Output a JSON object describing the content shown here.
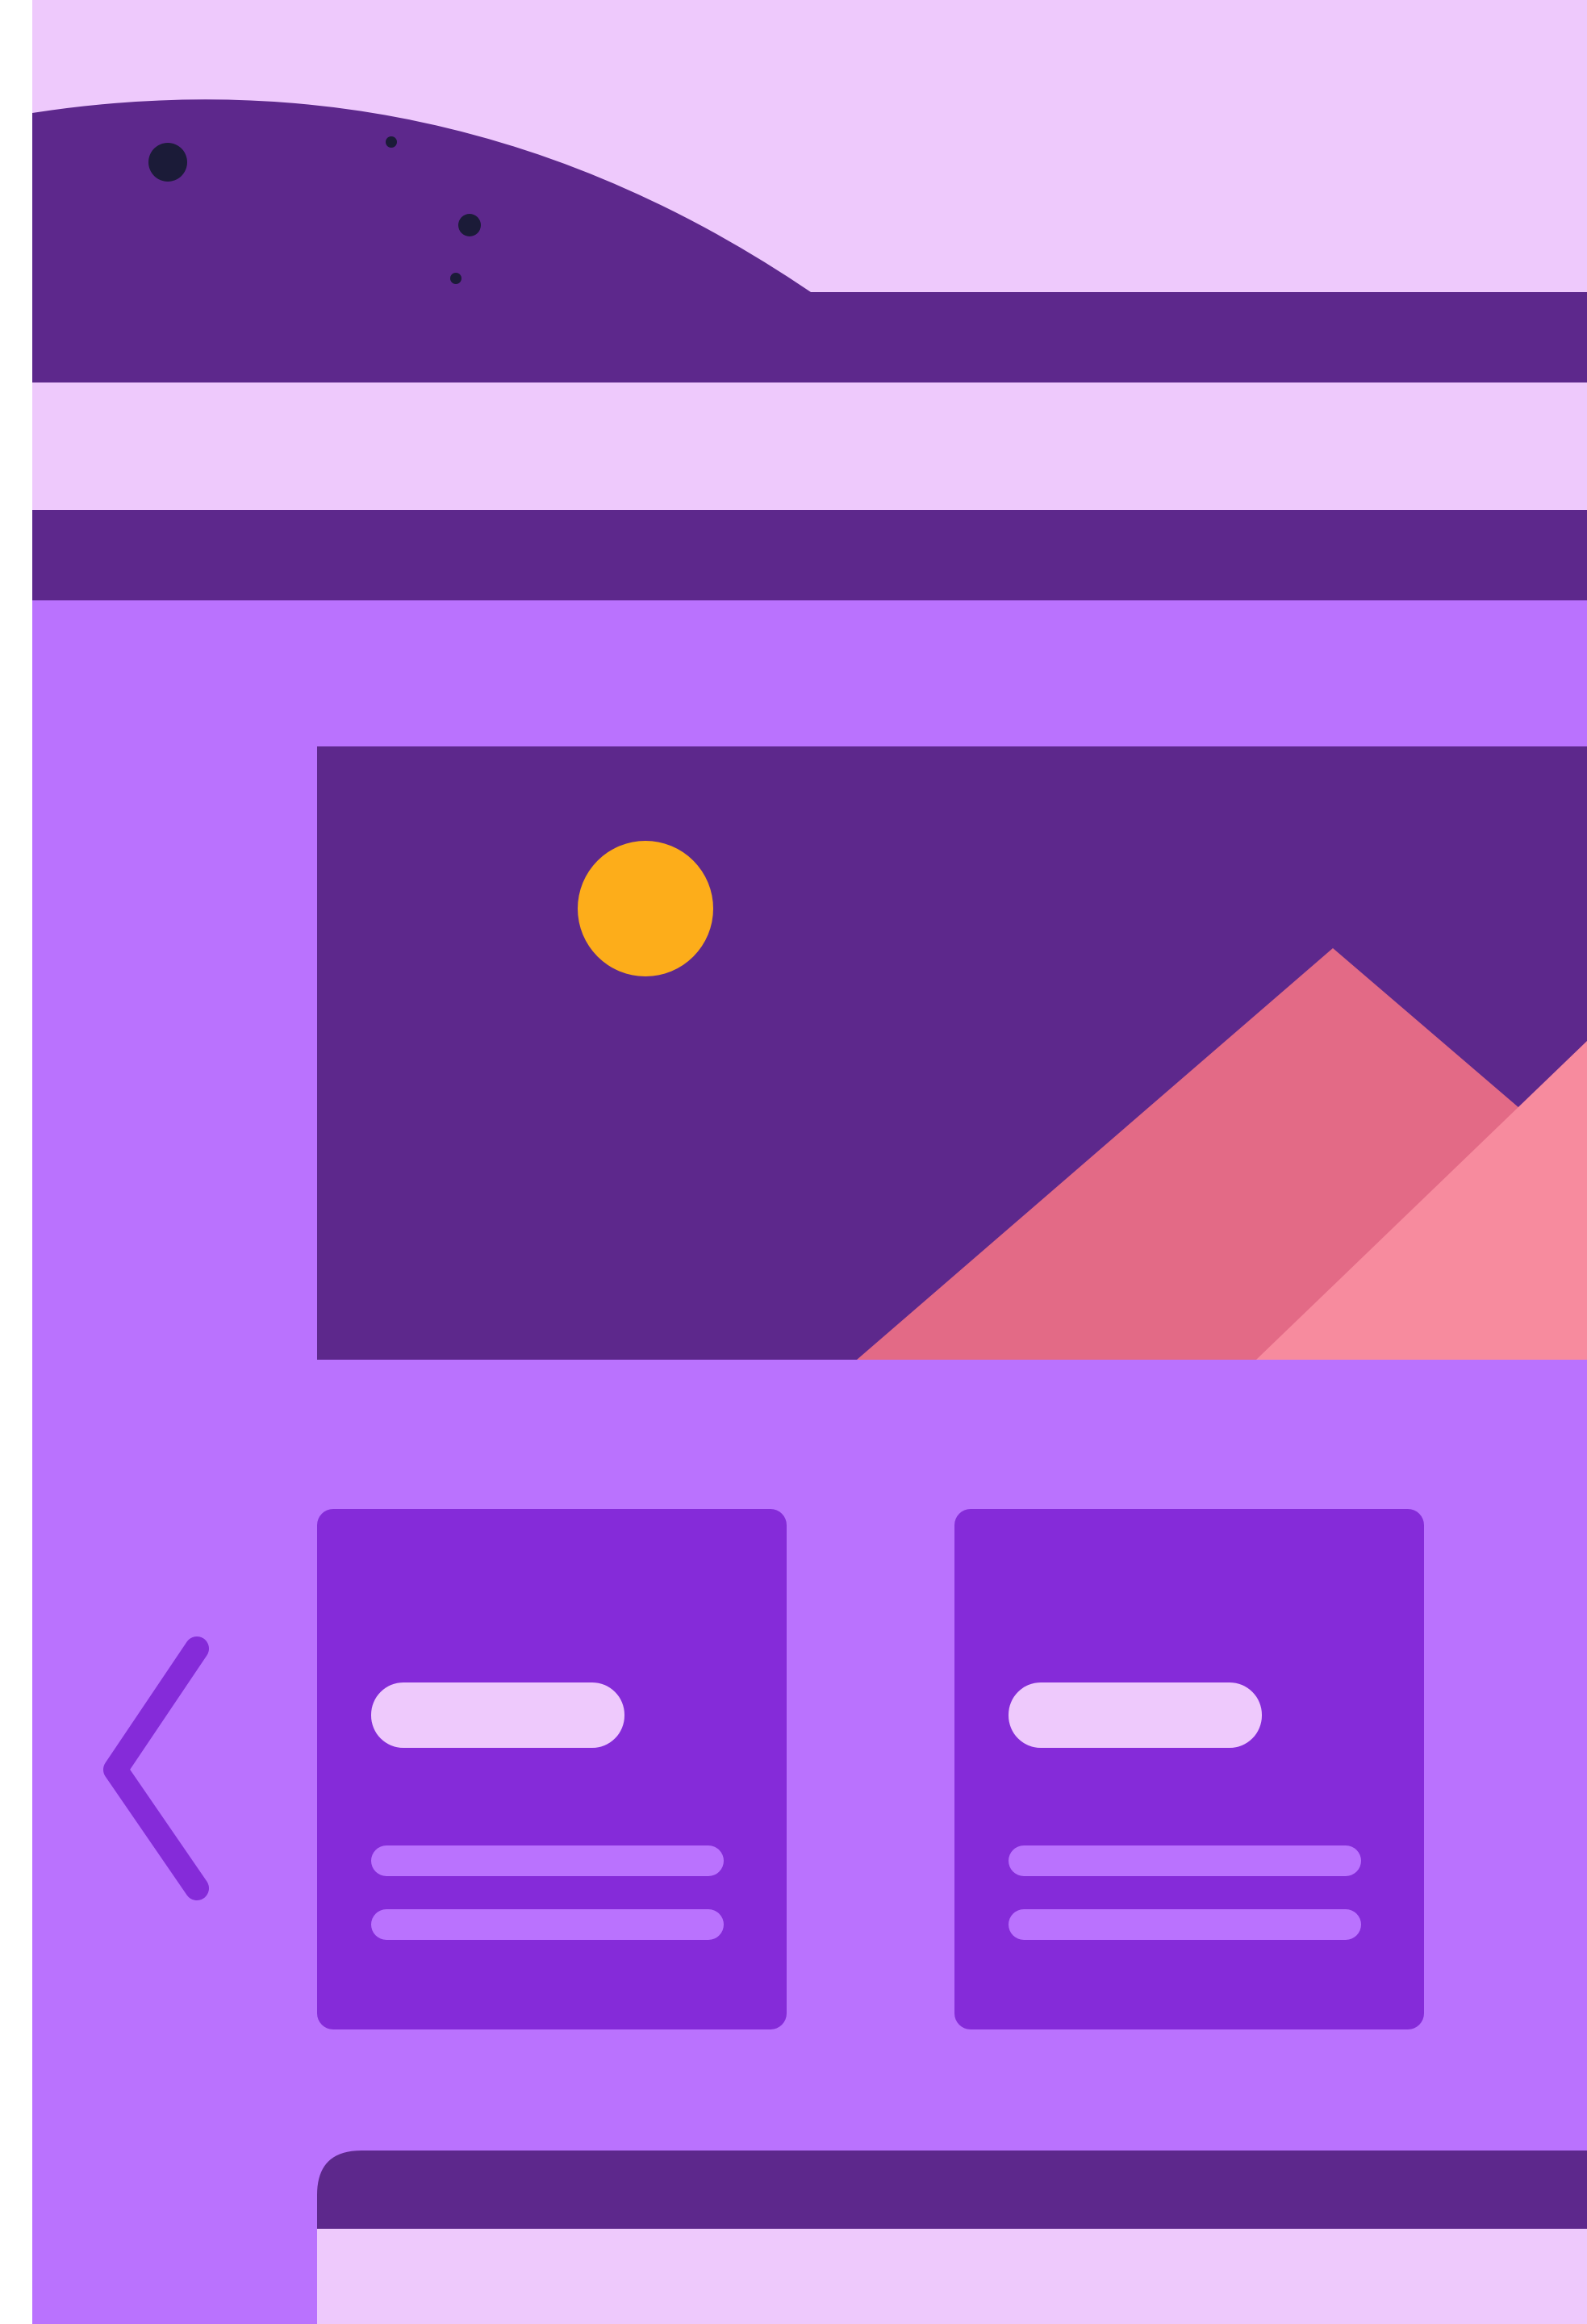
{
  "colors": {
    "lavender": "#EEC9FC",
    "dark_purple": "#5D288C",
    "mid_purple": "#BA72FE",
    "card_purple": "#852BD9",
    "sun": "#FDAD1A",
    "mountain_back": "#E36A86",
    "mountain_front": "#F78B9E",
    "speck": "#1B1B38",
    "page_bg": "#FFFFFF"
  },
  "header": {
    "icon": "hill-scene"
  },
  "hero_image": {
    "icon": "image-placeholder-icon",
    "sun_icon": "sun-icon",
    "mountains_icon": "mountains-icon"
  },
  "carousel": {
    "prev_icon": "chevron-left-icon",
    "cards": [
      {
        "icon": "card-placeholder"
      },
      {
        "icon": "card-placeholder"
      }
    ]
  },
  "bottom_panel": {
    "icon": "panel-placeholder"
  }
}
